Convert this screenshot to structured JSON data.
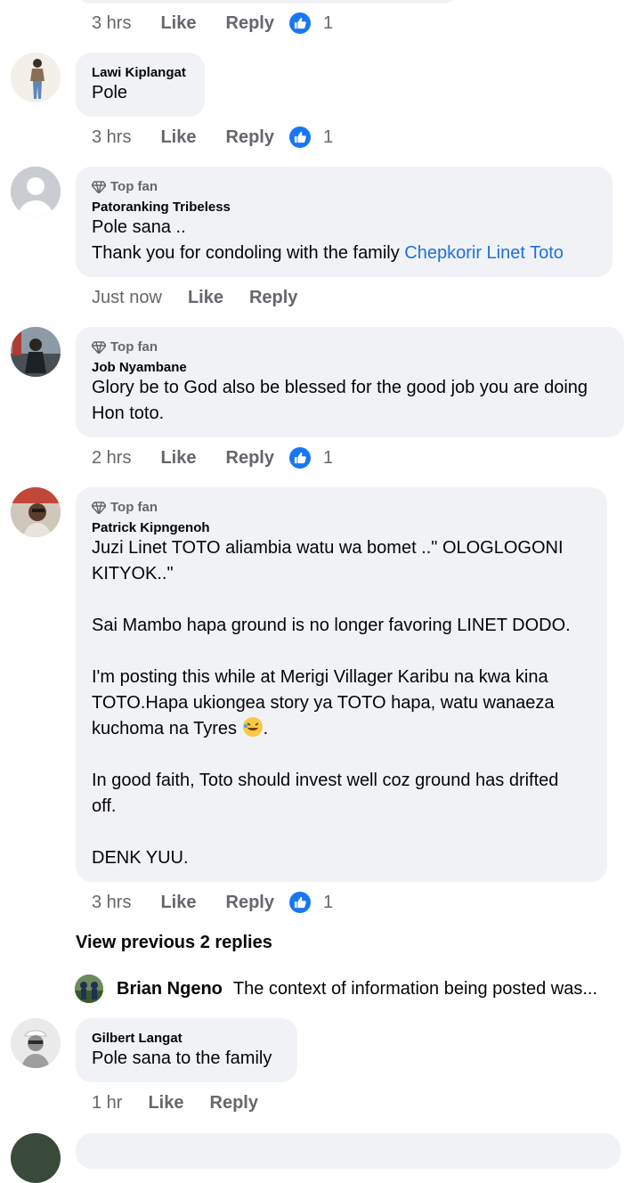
{
  "top": {
    "time": "3 hrs",
    "like": "Like",
    "reply": "Reply",
    "reactions": "1"
  },
  "comments": [
    {
      "author": "Lawi Kiplangat",
      "lines": [
        "Pole"
      ],
      "time": "3 hrs",
      "like": "Like",
      "reply": "Reply",
      "reactions": "1"
    },
    {
      "badge": "Top fan",
      "author": "Patoranking Tribeless",
      "line1": "Pole sana ..",
      "line2_prefix": "Thank you for condoling with the family ",
      "mention": "Chepkorir Linet Toto",
      "time": "Just now",
      "like": "Like",
      "reply": "Reply"
    },
    {
      "badge": "Top fan",
      "author": "Job Nyambane",
      "line1": "Glory be to God also be blessed for the good job you are doing",
      "line2": "Hon toto.",
      "time": "2 hrs",
      "like": "Like",
      "reply": "Reply",
      "reactions": "1"
    },
    {
      "badge": "Top fan",
      "author": "Patrick Kipngenoh",
      "line1": "Juzi Linet TOTO aliambia watu wa bomet ..\" OLOGLOGONI",
      "line2": "KITYOK..\"",
      "line3": "Sai Mambo hapa ground is no longer favoring LINET DODO.",
      "line4": "I'm posting this while at Merigi Villager Karibu na kwa kina",
      "line5": "TOTO.Hapa ukiongea story ya TOTO hapa, watu wanaeza",
      "line6": "kuchoma na Tyres",
      "line6_suffix": ".",
      "line7": "In good faith, Toto should invest well coz ground has drifted",
      "line8": "off.",
      "line9": "DENK YUU.",
      "time": "3 hrs",
      "like": "Like",
      "reply": "Reply",
      "reactions": "1"
    }
  ],
  "view_previous": "View previous 2 replies",
  "reply_preview": {
    "author": "Brian Ngeno",
    "text": "The context of information being posted was..."
  },
  "last_comment": {
    "author": "Gilbert Langat",
    "text": "Pole sana to the family",
    "time": "1 hr",
    "like": "Like",
    "reply": "Reply"
  },
  "colors": {
    "bubble": "#f0f2f5",
    "meta": "#65676b",
    "mention": "#216fdb",
    "like_blue": "#1877f2"
  }
}
